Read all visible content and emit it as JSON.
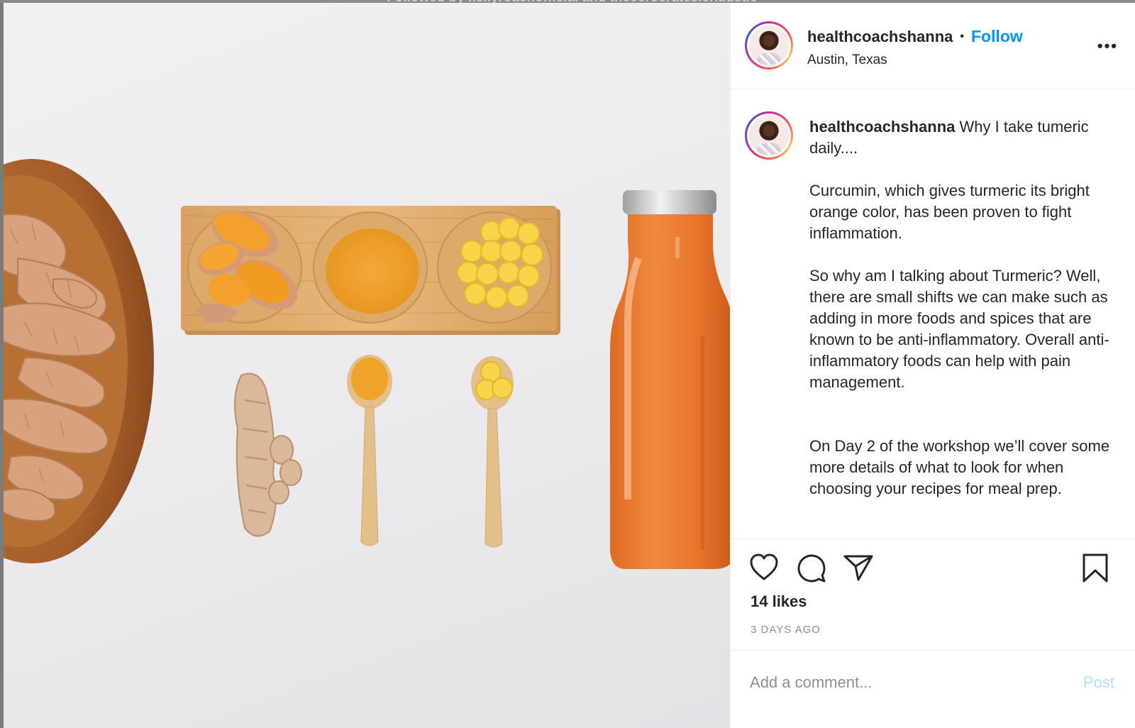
{
  "backdrop": {
    "followed_text": "Followed by kellyroachofficial and theceroerateslendustic"
  },
  "post": {
    "photo_alt": "Turmeric roots, powder, tablets and juice bottle",
    "author": "healthcoachshanna",
    "follow_label": "Follow",
    "separator": "•",
    "location": "Austin, Texas",
    "more_label": "•••"
  },
  "caption": {
    "username": "healthcoachshanna",
    "first_line": "Why I take tumeric daily....",
    "paragraphs": [
      "Curcumin, which gives turmeric its bright orange color, has been proven to fight inflammation.",
      "So why am I talking about Turmeric? Well, there are small shifts we can make such as adding in more foods and spices that are known to be anti-inflammatory. Overall anti-inflammatory foods can help with pain management.",
      "On Day 2 of the workshop we’ll cover some more details of what to look for when choosing your recipes for meal prep."
    ]
  },
  "actions": {
    "like_icon": "heart-icon",
    "comment_icon": "comment-icon",
    "share_icon": "paper-plane-icon",
    "save_icon": "bookmark-icon",
    "likes": "14 likes",
    "time_ago": "3 DAYS AGO"
  },
  "comment": {
    "placeholder": "Add a comment...",
    "post_label": "Post"
  },
  "colors": {
    "accent": "#0095f6",
    "post_disabled": "#b2dffc",
    "text": "#262626",
    "muted": "#8e8e8e",
    "turmeric": "#f0a32a",
    "juice": "#e8732a"
  }
}
